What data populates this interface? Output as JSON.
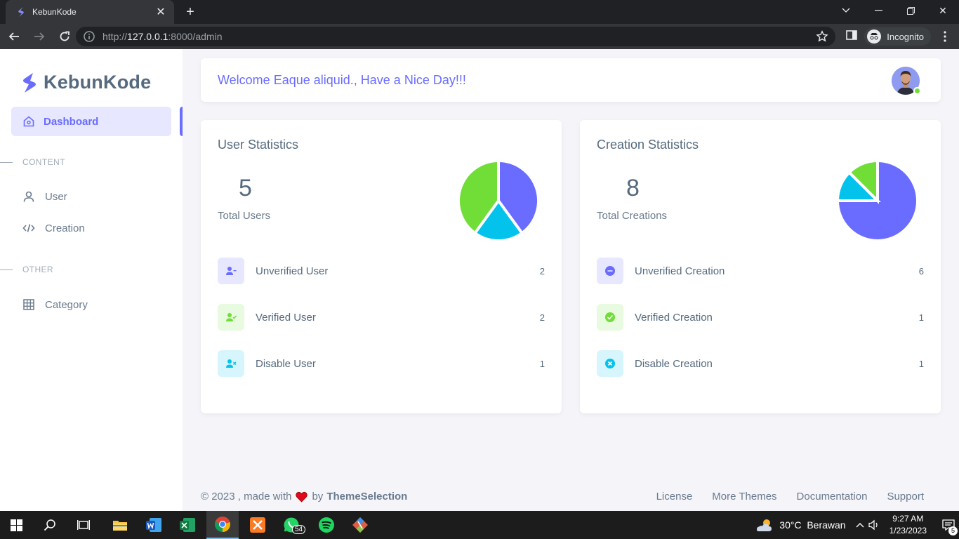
{
  "browser": {
    "tab_title": "KebunKode",
    "url_prefix": "http://",
    "url_host": "127.0.0.1",
    "url_rest": ":8000/admin",
    "incognito_label": "Incognito"
  },
  "sidebar": {
    "brand": "KebunKode",
    "active_item": "Dashboard",
    "sections": [
      {
        "header": "CONTENT",
        "items": [
          "User",
          "Creation"
        ]
      },
      {
        "header": "OTHER",
        "items": [
          "Category"
        ]
      }
    ]
  },
  "welcome": {
    "text": "Welcome Eaque aliquid., Have a Nice Day!!!"
  },
  "user_stats": {
    "title": "User Statistics",
    "total": "5",
    "total_label": "Total Users",
    "rows": [
      {
        "label": "Unverified User",
        "value": "2",
        "icon": "user-minus-icon"
      },
      {
        "label": "Verified User",
        "value": "2",
        "icon": "user-check-icon"
      },
      {
        "label": "Disable User",
        "value": "1",
        "icon": "user-x-icon"
      }
    ],
    "pie": [
      {
        "label": "Unverified User",
        "value": 2,
        "color": "#696cff"
      },
      {
        "label": "Disable User",
        "value": 1,
        "color": "#03c3ec"
      },
      {
        "label": "Verified User",
        "value": 2,
        "color": "#71dd37"
      }
    ]
  },
  "creation_stats": {
    "title": "Creation Statistics",
    "total": "8",
    "total_label": "Total Creations",
    "rows": [
      {
        "label": "Unverified Creation",
        "value": "6",
        "icon": "minus-circle-icon"
      },
      {
        "label": "Verified Creation",
        "value": "1",
        "icon": "check-circle-icon"
      },
      {
        "label": "Disable Creation",
        "value": "1",
        "icon": "x-circle-icon"
      }
    ],
    "pie": [
      {
        "label": "Unverified Creation",
        "value": 6,
        "color": "#696cff"
      },
      {
        "label": "Disable Creation",
        "value": 1,
        "color": "#03c3ec"
      },
      {
        "label": "Verified Creation",
        "value": 1,
        "color": "#71dd37"
      }
    ]
  },
  "footer": {
    "left_prefix": "© 2023 , made with",
    "by": "by",
    "author": "ThemeSelection",
    "links": [
      "License",
      "More Themes",
      "Documentation",
      "Support"
    ]
  },
  "taskbar": {
    "whatsapp_badge": "54",
    "weather": "30°C  Berawan",
    "time": "9:27 AM",
    "date": "1/23/2023",
    "notifications": "5"
  }
}
